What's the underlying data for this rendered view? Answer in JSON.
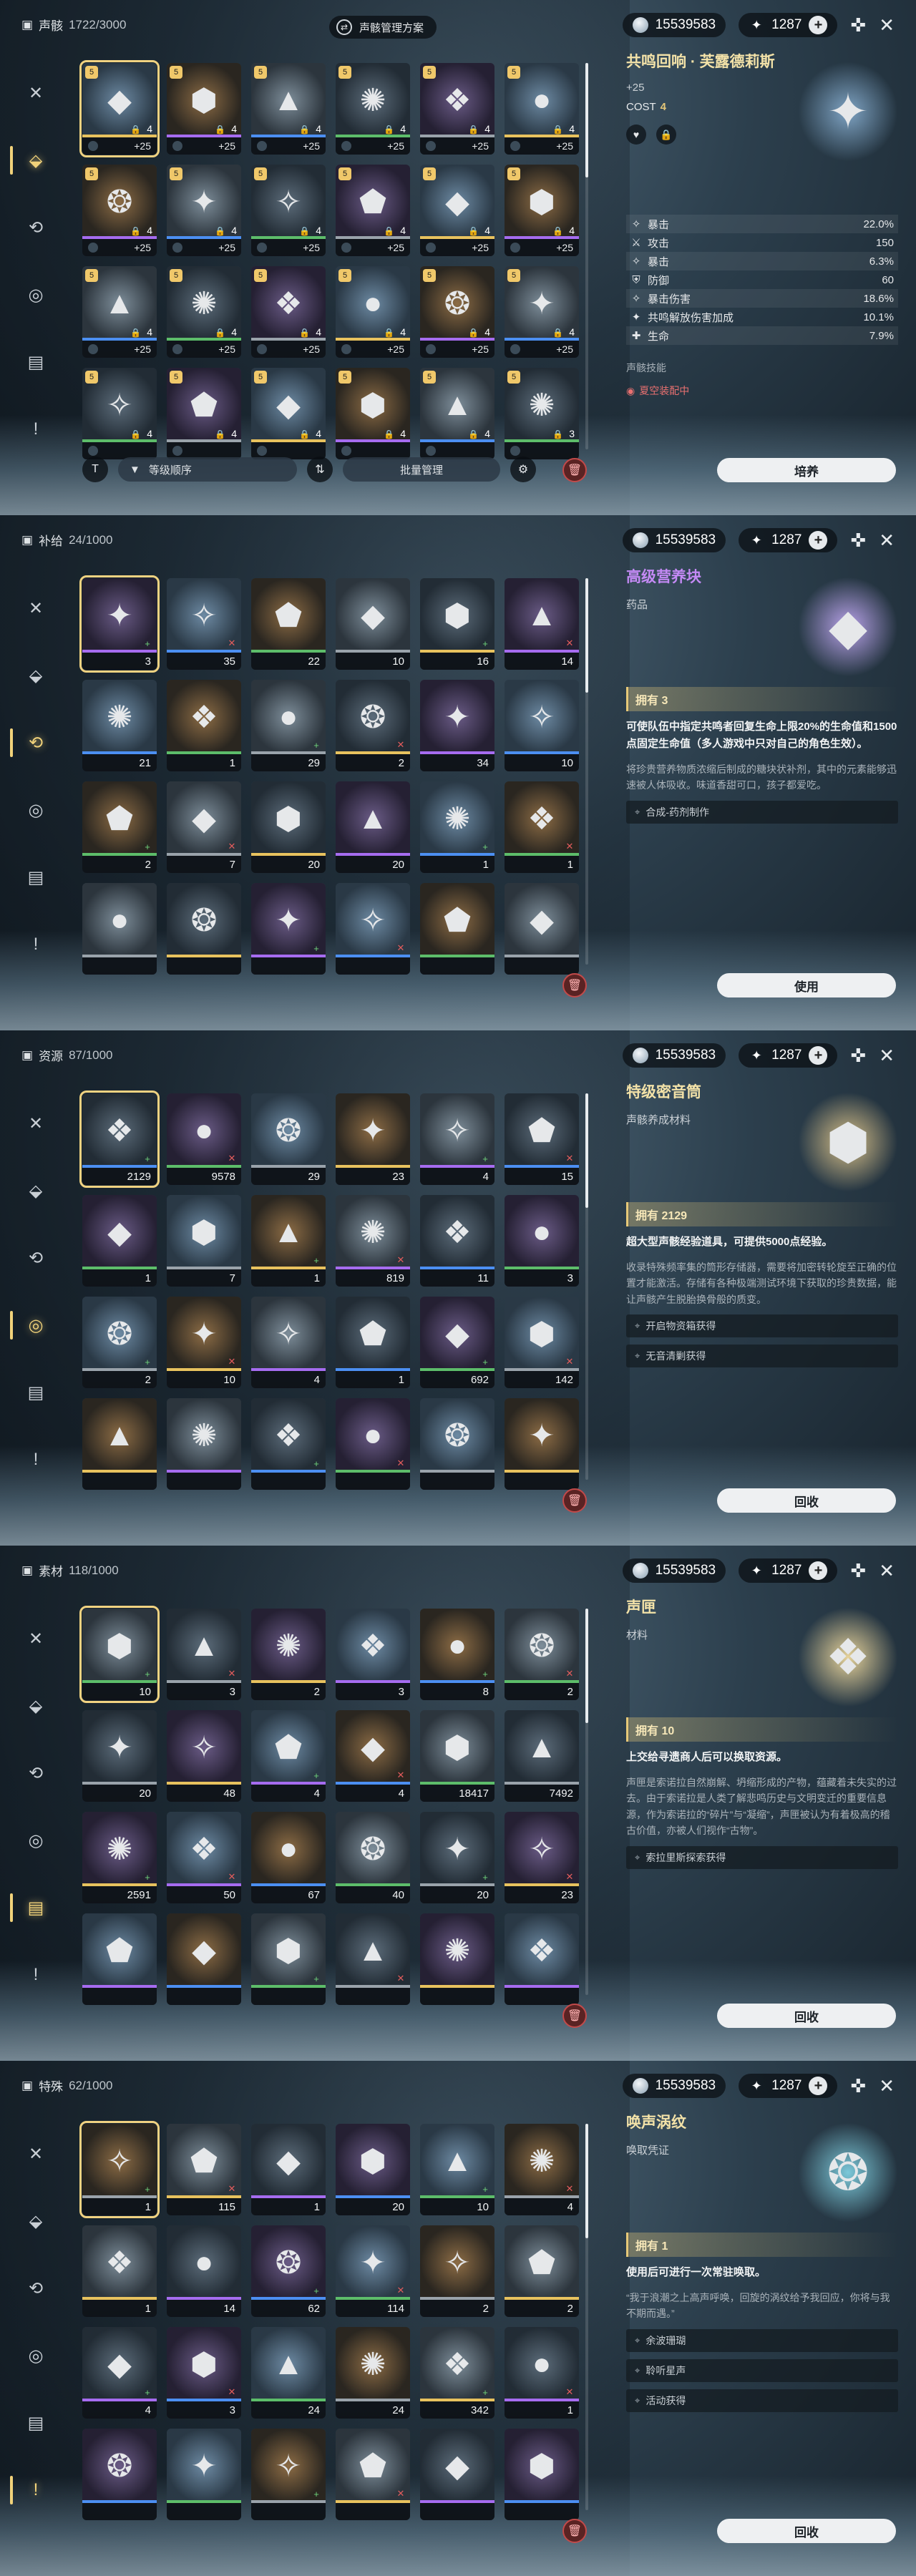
{
  "topbar": {
    "coins": "15539583",
    "stars": "1287"
  },
  "panels": [
    {
      "title": "声骸",
      "count": "1722/3000",
      "scheme_label": "声骸管理方案",
      "detail": {
        "name": "共鸣回响 · 芙露德莉斯",
        "plus": "+25",
        "cost_label": "COST",
        "cost_value": "4",
        "stats": [
          {
            "name": "暴击",
            "value": "22.0%"
          },
          {
            "name": "攻击",
            "value": "150"
          },
          {
            "name": "暴击",
            "value": "6.3%"
          },
          {
            "name": "防御",
            "value": "60"
          },
          {
            "name": "暴击伤害",
            "value": "18.6%"
          },
          {
            "name": "共鸣解放伤害加成",
            "value": "10.1%"
          },
          {
            "name": "生命",
            "value": "7.9%"
          }
        ],
        "skill_label": "声骸技能",
        "equipped_label": "夏空装配中"
      },
      "sort_label": "等级顺序",
      "batch_label": "批量管理",
      "action": "培养",
      "cells": [
        {
          "l": "+25",
          "c": "4"
        },
        {
          "l": "+25",
          "c": "4"
        },
        {
          "l": "+25",
          "c": "4"
        },
        {
          "l": "+25",
          "c": "4"
        },
        {
          "l": "+25",
          "c": "4"
        },
        {
          "l": "+25",
          "c": "4"
        },
        {
          "l": "+25",
          "c": "4"
        },
        {
          "l": "+25",
          "c": "4"
        },
        {
          "l": "+25",
          "c": "4"
        },
        {
          "l": "+25",
          "c": "4"
        },
        {
          "l": "+25",
          "c": "4"
        },
        {
          "l": "+25",
          "c": "4"
        },
        {
          "l": "+25",
          "c": "4"
        },
        {
          "l": "+25",
          "c": "4"
        },
        {
          "l": "+25",
          "c": "4"
        },
        {
          "l": "+25",
          "c": "4"
        },
        {
          "l": "+25",
          "c": "4"
        },
        {
          "l": "+25",
          "c": "4"
        },
        {
          "l": "",
          "c": "4"
        },
        {
          "l": "",
          "c": "4"
        },
        {
          "l": "",
          "c": "4"
        },
        {
          "l": "",
          "c": "4"
        },
        {
          "l": "",
          "c": "4"
        },
        {
          "l": "",
          "c": "3"
        }
      ]
    },
    {
      "title": "补给",
      "count": "24/1000",
      "detail": {
        "name": "高级营养块",
        "sub": "药品",
        "owned": "拥有 3",
        "lead": "可使队伍中指定共鸣者回复生命上限20%的生命值和1500点固定生命值（多人游戏中只对自己的角色生效）。",
        "desc": "将珍贵营养物质浓缩后制成的糖块状补剂，其中的元素能够迅速被人体吸收。味道香甜可口，孩子都爱吃。",
        "sources": [
          "合成-药剂制作"
        ]
      },
      "action": "使用",
      "cells": [
        "3",
        "35",
        "22",
        "10",
        "16",
        "14",
        "21",
        "1",
        "29",
        "2",
        "34",
        "10",
        "2",
        "7",
        "20",
        "20",
        "1",
        "1",
        "",
        "",
        "",
        "",
        "",
        ""
      ]
    },
    {
      "title": "资源",
      "count": "87/1000",
      "detail": {
        "name": "特级密音筒",
        "sub": "声骸养成材料",
        "owned": "拥有 2129",
        "lead": "超大型声骸经验道具，可提供5000点经验。",
        "desc": "收录特殊频率集的筒形存储器，需要将加密转轮旋至正确的位置才能激活。存储有各种极端测试环境下获取的珍贵数据，能让声骸产生脱胎换骨般的质变。",
        "sources": [
          "开启物资箱获得",
          "无音清剿获得"
        ]
      },
      "action": "回收",
      "cells": [
        "2129",
        "9578",
        "29",
        "23",
        "4",
        "15",
        "1",
        "7",
        "1",
        "819",
        "11",
        "3",
        "2",
        "10",
        "4",
        "1",
        "692",
        "142",
        "",
        "",
        "",
        "",
        "",
        ""
      ]
    },
    {
      "title": "素材",
      "count": "118/1000",
      "detail": {
        "name": "声匣",
        "sub": "材料",
        "owned": "拥有 10",
        "lead": "上交给寻遗商人后可以换取资源。",
        "desc": "声匣是索诺拉自然崩解、坍缩形成的产物，蕴藏着未失实的过去。由于索诺拉是人类了解悲鸣历史与文明变迁的重要信息源，作为索诺拉的“碎片”与“凝缩”，声匣被认为有着极高的稽古价值，亦被人们视作“古物”。",
        "sources": [
          "索拉里斯探索获得"
        ]
      },
      "action": "回收",
      "cells": [
        "10",
        "3",
        "2",
        "3",
        "8",
        "2",
        "20",
        "48",
        "4",
        "4",
        "18417",
        "7492",
        "2591",
        "50",
        "67",
        "40",
        "20",
        "23",
        "",
        "",
        "",
        "",
        "",
        ""
      ]
    },
    {
      "title": "特殊",
      "count": "62/1000",
      "detail": {
        "name": "唤声涡纹",
        "sub": "唤取凭证",
        "owned": "拥有 1",
        "lead": "使用后可进行一次常驻唤取。",
        "desc": "“我于浪潮之上高声呼唤，回旋的涡纹给予我回应，你将与我不期而遇。”",
        "sources": [
          "余波珊瑚",
          "聆听星声",
          "活动获得"
        ]
      },
      "action": "回收",
      "cells": [
        "1",
        "115",
        "1",
        "20",
        "10",
        "4",
        "1",
        "14",
        "62",
        "114",
        "2",
        "2",
        "4",
        "3",
        "24",
        "24",
        "342",
        "1",
        "",
        "",
        "",
        "",
        "",
        ""
      ]
    }
  ]
}
